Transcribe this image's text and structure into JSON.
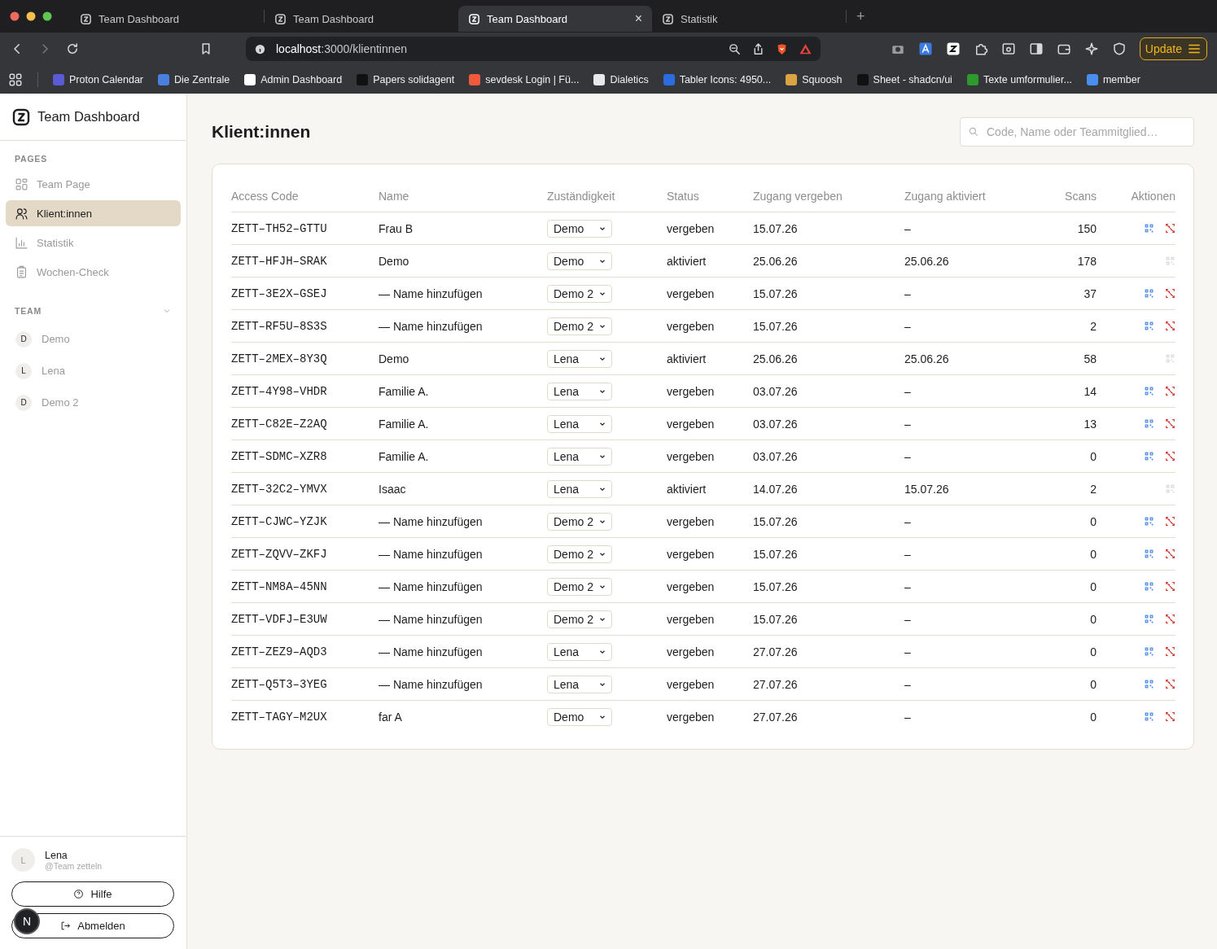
{
  "browser": {
    "tabs": [
      {
        "title": "Team Dashboard",
        "selected": false
      },
      {
        "title": "Team Dashboard",
        "selected": false
      },
      {
        "title": "Team Dashboard",
        "selected": true
      },
      {
        "title": "Statistik",
        "selected": false
      }
    ],
    "new_tab": "+",
    "close_tab": "×",
    "url_host": "localhost",
    "url_path": ":3000/klientinnen",
    "update_button": "Update",
    "bookmarks": [
      {
        "label": "Proton Calendar",
        "color": "#5b5bd6"
      },
      {
        "label": "Die Zentrale",
        "color": "#4a7fe0"
      },
      {
        "label": "Admin Dashboard",
        "color": "#ffffff"
      },
      {
        "label": "Papers solidagent",
        "color": "#111111"
      },
      {
        "label": "sevdesk Login | Fü...",
        "color": "#f05a3c"
      },
      {
        "label": "Dialetics",
        "color": "#e8e8ea"
      },
      {
        "label": "Tabler Icons: 4950...",
        "color": "#2b6de0"
      },
      {
        "label": "Squoosh",
        "color": "#d9a441"
      },
      {
        "label": "Sheet - shadcn/ui",
        "color": "#111111"
      },
      {
        "label": "Texte umformulier...",
        "color": "#2e9a2e"
      },
      {
        "label": "member",
        "color": "#4a8ef0"
      }
    ]
  },
  "sidebar": {
    "title": "Team Dashboard",
    "pages_heading": "PAGES",
    "pages": [
      {
        "label": "Team Page",
        "selected": false
      },
      {
        "label": "Klient:innen",
        "selected": true
      },
      {
        "label": "Statistik",
        "selected": false
      },
      {
        "label": "Wochen-Check",
        "selected": false
      }
    ],
    "team_heading": "TEAM",
    "team_expanded": true,
    "team": [
      {
        "initial": "D",
        "name": "Demo"
      },
      {
        "initial": "L",
        "name": "Lena"
      },
      {
        "initial": "D",
        "name": "Demo 2"
      }
    ],
    "user": {
      "initial": "L",
      "name": "Lena",
      "handle": "@Team zetteln"
    },
    "help_button": "Hilfe",
    "logout_button": "Abmelden",
    "dev_indicator": "N"
  },
  "page": {
    "title": "Klient:innen",
    "search": {
      "placeholder": "Code, Name oder Teammitglied…"
    }
  },
  "table": {
    "columns": [
      "Access Code",
      "Name",
      "Zuständigkeit",
      "Status",
      "Zugang vergeben",
      "Zugang aktiviert",
      "Scans",
      "Aktionen"
    ],
    "rows": [
      {
        "code": "ZETT–TH52–GTTU",
        "name": "Frau B",
        "assignee": "Demo",
        "status": "vergeben",
        "issued": "15.07.26",
        "activated": "–",
        "scans": "150",
        "revocable": true
      },
      {
        "code": "ZETT–HFJH–SRAK",
        "name": "Demo",
        "assignee": "Demo",
        "status": "aktiviert",
        "issued": "25.06.26",
        "activated": "25.06.26",
        "scans": "178",
        "revocable": false
      },
      {
        "code": "ZETT–3E2X–GSEJ",
        "name": "— Name hinzufügen",
        "assignee": "Demo 2",
        "status": "vergeben",
        "issued": "15.07.26",
        "activated": "–",
        "scans": "37",
        "revocable": true
      },
      {
        "code": "ZETT–RF5U–8S3S",
        "name": "— Name hinzufügen",
        "assignee": "Demo 2",
        "status": "vergeben",
        "issued": "15.07.26",
        "activated": "–",
        "scans": "2",
        "revocable": true
      },
      {
        "code": "ZETT–2MEX–8Y3Q",
        "name": "Demo",
        "assignee": "Lena",
        "status": "aktiviert",
        "issued": "25.06.26",
        "activated": "25.06.26",
        "scans": "58",
        "revocable": false
      },
      {
        "code": "ZETT–4Y98–VHDR",
        "name": "Familie A.",
        "assignee": "Lena",
        "status": "vergeben",
        "issued": "03.07.26",
        "activated": "–",
        "scans": "14",
        "revocable": true
      },
      {
        "code": "ZETT–C82E–Z2AQ",
        "name": "Familie A.",
        "assignee": "Lena",
        "status": "vergeben",
        "issued": "03.07.26",
        "activated": "–",
        "scans": "13",
        "revocable": true
      },
      {
        "code": "ZETT–SDMC–XZR8",
        "name": "Familie A.",
        "assignee": "Lena",
        "status": "vergeben",
        "issued": "03.07.26",
        "activated": "–",
        "scans": "0",
        "revocable": true
      },
      {
        "code": "ZETT–32C2–YMVX",
        "name": "Isaac",
        "assignee": "Lena",
        "status": "aktiviert",
        "issued": "14.07.26",
        "activated": "15.07.26",
        "scans": "2",
        "revocable": false
      },
      {
        "code": "ZETT–CJWC–YZJK",
        "name": "— Name hinzufügen",
        "assignee": "Demo 2",
        "status": "vergeben",
        "issued": "15.07.26",
        "activated": "–",
        "scans": "0",
        "revocable": true
      },
      {
        "code": "ZETT–ZQVV–ZKFJ",
        "name": "— Name hinzufügen",
        "assignee": "Demo 2",
        "status": "vergeben",
        "issued": "15.07.26",
        "activated": "–",
        "scans": "0",
        "revocable": true
      },
      {
        "code": "ZETT–NM8A–45NN",
        "name": "— Name hinzufügen",
        "assignee": "Demo 2",
        "status": "vergeben",
        "issued": "15.07.26",
        "activated": "–",
        "scans": "0",
        "revocable": true
      },
      {
        "code": "ZETT–VDFJ–E3UW",
        "name": "— Name hinzufügen",
        "assignee": "Demo 2",
        "status": "vergeben",
        "issued": "15.07.26",
        "activated": "–",
        "scans": "0",
        "revocable": true
      },
      {
        "code": "ZETT–ZEZ9–AQD3",
        "name": "— Name hinzufügen",
        "assignee": "Lena",
        "status": "vergeben",
        "issued": "27.07.26",
        "activated": "–",
        "scans": "0",
        "revocable": true
      },
      {
        "code": "ZETT–Q5T3–3YEG",
        "name": "— Name hinzufügen",
        "assignee": "Lena",
        "status": "vergeben",
        "issued": "27.07.26",
        "activated": "–",
        "scans": "0",
        "revocable": true
      },
      {
        "code": "ZETT–TAGY–M2UX",
        "name": "far A",
        "assignee": "Demo",
        "status": "vergeben",
        "issued": "27.07.26",
        "activated": "–",
        "scans": "0",
        "revocable": true
      }
    ]
  }
}
